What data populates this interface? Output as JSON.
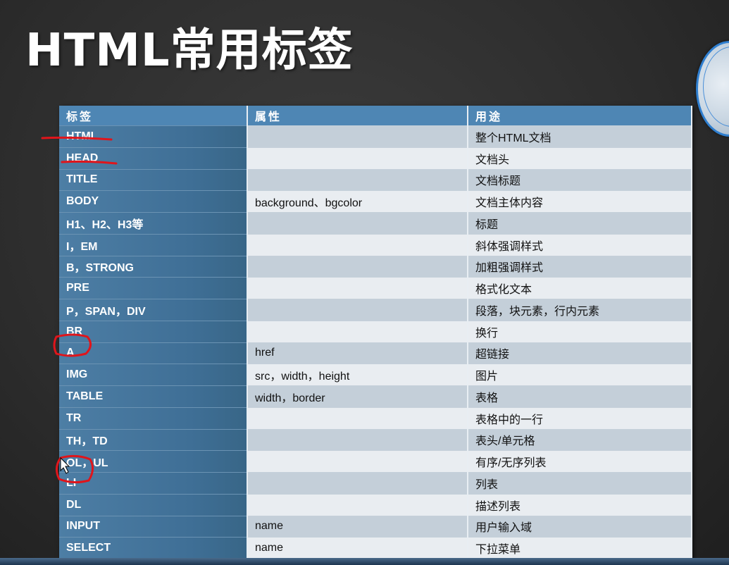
{
  "slide": {
    "title": "HTML常用标签"
  },
  "table": {
    "headers": [
      "标签",
      "属性",
      "用途"
    ],
    "rows": [
      {
        "tag": "HTML",
        "attr": "",
        "use": "整个HTML文档"
      },
      {
        "tag": "HEAD",
        "attr": "",
        "use": "文档头"
      },
      {
        "tag": "TITLE",
        "attr": "",
        "use": "文档标题"
      },
      {
        "tag": "BODY",
        "attr": "background、bgcolor",
        "use": "文档主体内容"
      },
      {
        "tag": "H1、H2、H3等",
        "attr": "",
        "use": "标题"
      },
      {
        "tag": "I，EM",
        "attr": "",
        "use": "斜体强调样式"
      },
      {
        "tag": "B，STRONG",
        "attr": "",
        "use": "加粗强调样式"
      },
      {
        "tag": "PRE",
        "attr": "",
        "use": "格式化文本"
      },
      {
        "tag": "P，SPAN，DIV",
        "attr": "",
        "use": "段落，块元素，行内元素"
      },
      {
        "tag": "BR",
        "attr": "",
        "use": "换行"
      },
      {
        "tag": "A",
        "attr": "href",
        "use": "超链接"
      },
      {
        "tag": "IMG",
        "attr": "src，width，height",
        "use": "图片"
      },
      {
        "tag": "TABLE",
        "attr": "width，border",
        "use": "表格"
      },
      {
        "tag": "TR",
        "attr": "",
        "use": "表格中的一行"
      },
      {
        "tag": "TH，TD",
        "attr": "",
        "use": "表头/单元格"
      },
      {
        "tag": "OL，UL",
        "attr": "",
        "use": "有序/无序列表"
      },
      {
        "tag": "LI",
        "attr": "",
        "use": "列表"
      },
      {
        "tag": "DL",
        "attr": "",
        "use": "描述列表"
      },
      {
        "tag": "INPUT",
        "attr": "name",
        "use": "用户输入域"
      },
      {
        "tag": "SELECT",
        "attr": "name",
        "use": "下拉菜单"
      }
    ]
  },
  "annotations": {
    "color": "#e0151b",
    "underlined_rows": [
      "HTML",
      "HEAD"
    ],
    "circled_rows": [
      "A",
      "LI"
    ]
  }
}
